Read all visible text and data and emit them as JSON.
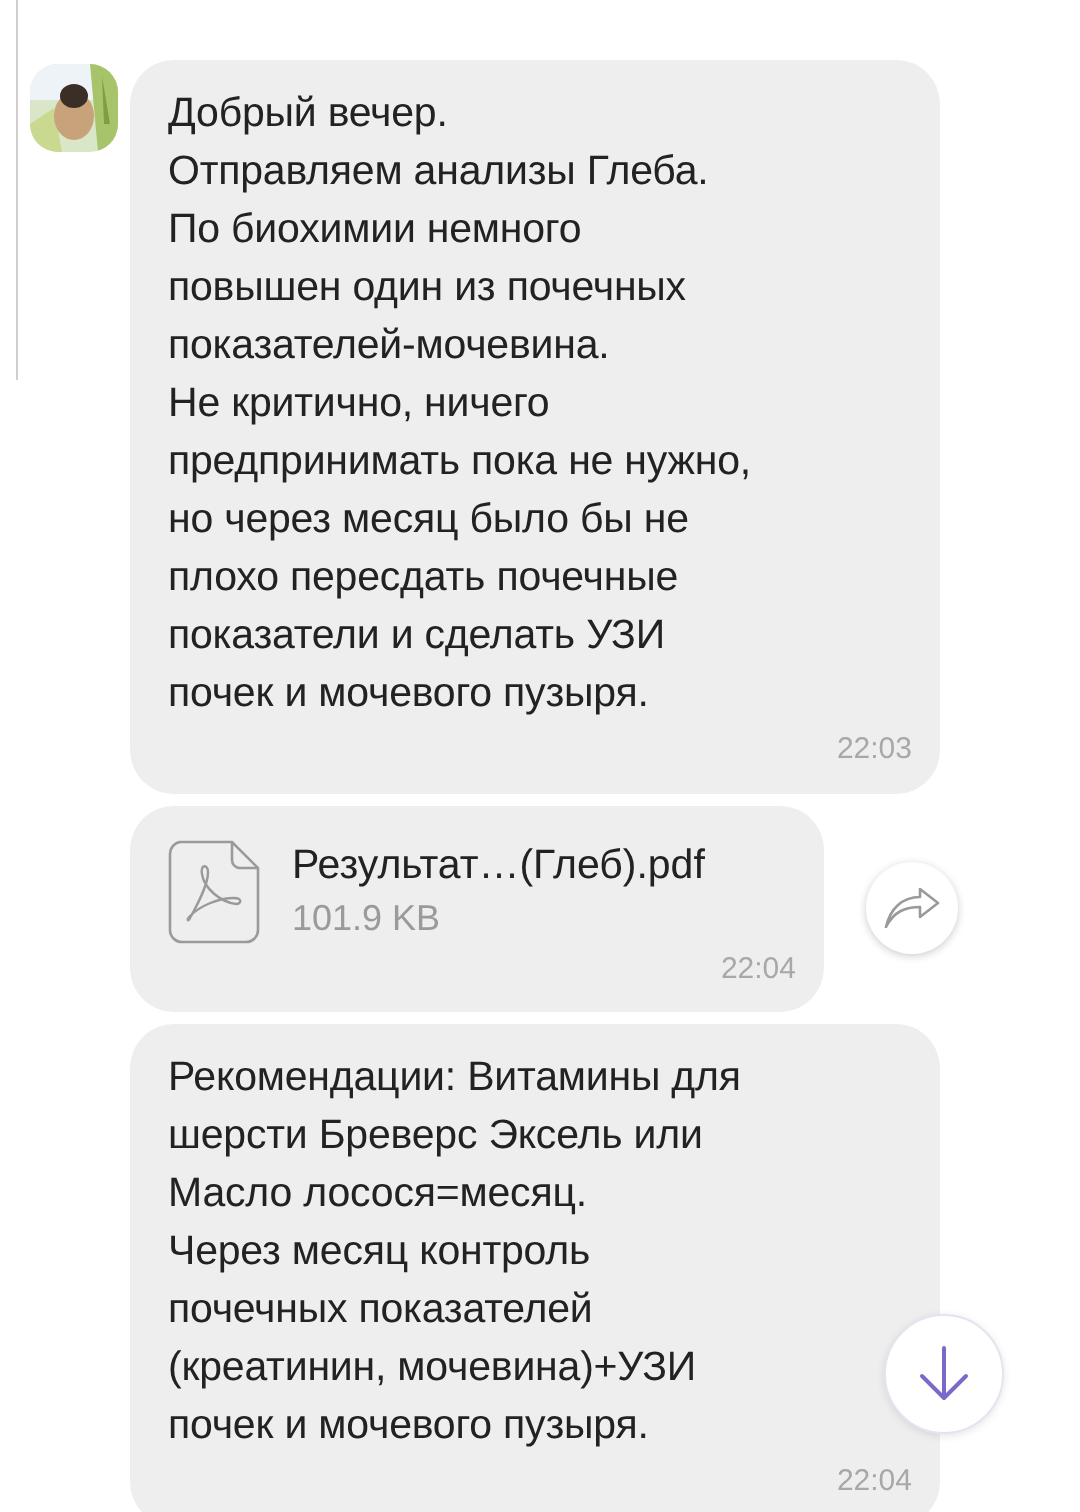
{
  "messages": [
    {
      "kind": "text",
      "text": "Добрый вечер.\nОтправляем анализы Глеба.\nПо биохимии немного\nповышен один из почечных\nпоказателей-мочевина.\nНе критично, ничего\nпредпринимать пока не нужно,\nно через месяц было бы не\nплохо пересдать почечные\nпоказатели и сделать УЗИ\nпочек и мочевого пузыря.",
      "time": "22:03"
    },
    {
      "kind": "file",
      "file_name": "Результат…(Глеб).pdf",
      "file_size": "101.9 KB",
      "time": "22:04"
    },
    {
      "kind": "text",
      "text": "Рекомендации: Витамины для\nшерсти Бреверс Эксель или\nМасло лосося=месяц.\nЧерез месяц контроль\nпочечных показателей\n(креатинин, мочевина)+УЗИ\nпочек и мочевого пузыря.",
      "time": "22:04"
    }
  ]
}
